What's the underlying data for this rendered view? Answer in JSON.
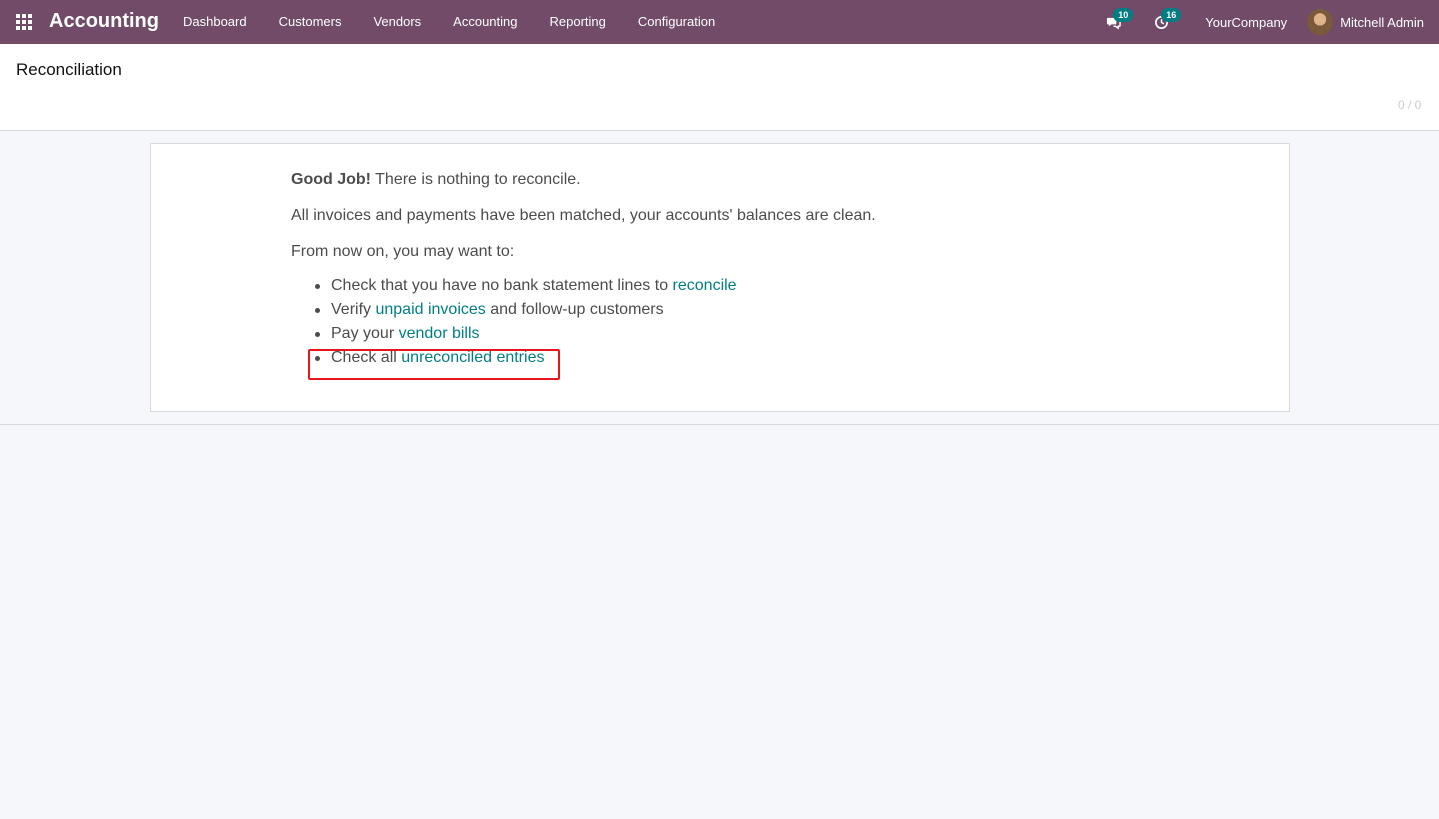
{
  "navbar": {
    "brand": "Accounting",
    "menu": [
      "Dashboard",
      "Customers",
      "Vendors",
      "Accounting",
      "Reporting",
      "Configuration"
    ],
    "messages_badge": "10",
    "activities_badge": "16",
    "company": "YourCompany",
    "user": "Mitchell Admin"
  },
  "control_panel": {
    "title": "Reconciliation",
    "pager": "0 / 0"
  },
  "content": {
    "good_job": "Good Job!",
    "nothing": "There is nothing to reconcile.",
    "matched": "All invoices and payments have been matched, your accounts' balances are clean.",
    "from_now": "From now on, you may want to:",
    "items": [
      {
        "before": "Check that you have no bank statement lines to",
        "link": "reconcile",
        "after": ""
      },
      {
        "before": "Verify",
        "link": "unpaid invoices",
        "after": "and follow-up customers"
      },
      {
        "before": "Pay your",
        "link": "vendor bills",
        "after": ""
      },
      {
        "before": "Check all",
        "link": "unreconciled entries",
        "after": ""
      }
    ]
  },
  "colors": {
    "navbar": "#714b67",
    "link": "#017e84",
    "badge": "#017e84",
    "highlight": "#e8151b"
  }
}
